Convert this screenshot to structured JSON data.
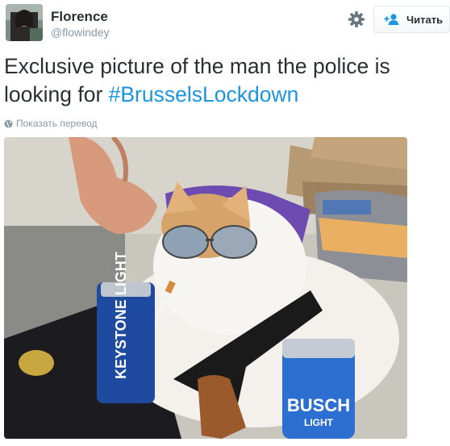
{
  "user": {
    "display_name": "Florence",
    "screen_name": "@flowindey"
  },
  "actions": {
    "follow_label": "Читать"
  },
  "tweet": {
    "text_before": "Exclusive picture of the man the police is looking for ",
    "hashtag": "#BrusselsLockdown",
    "translate_label": "Показать перевод"
  },
  "photo": {
    "can_left_text": "KEYSTONE LIGHT",
    "can_right_brand": "BUSCH",
    "can_right_sub": "LIGHT"
  },
  "colors": {
    "hashtag": "#1b95e0",
    "muted": "#8899a6",
    "text": "#292f33"
  }
}
